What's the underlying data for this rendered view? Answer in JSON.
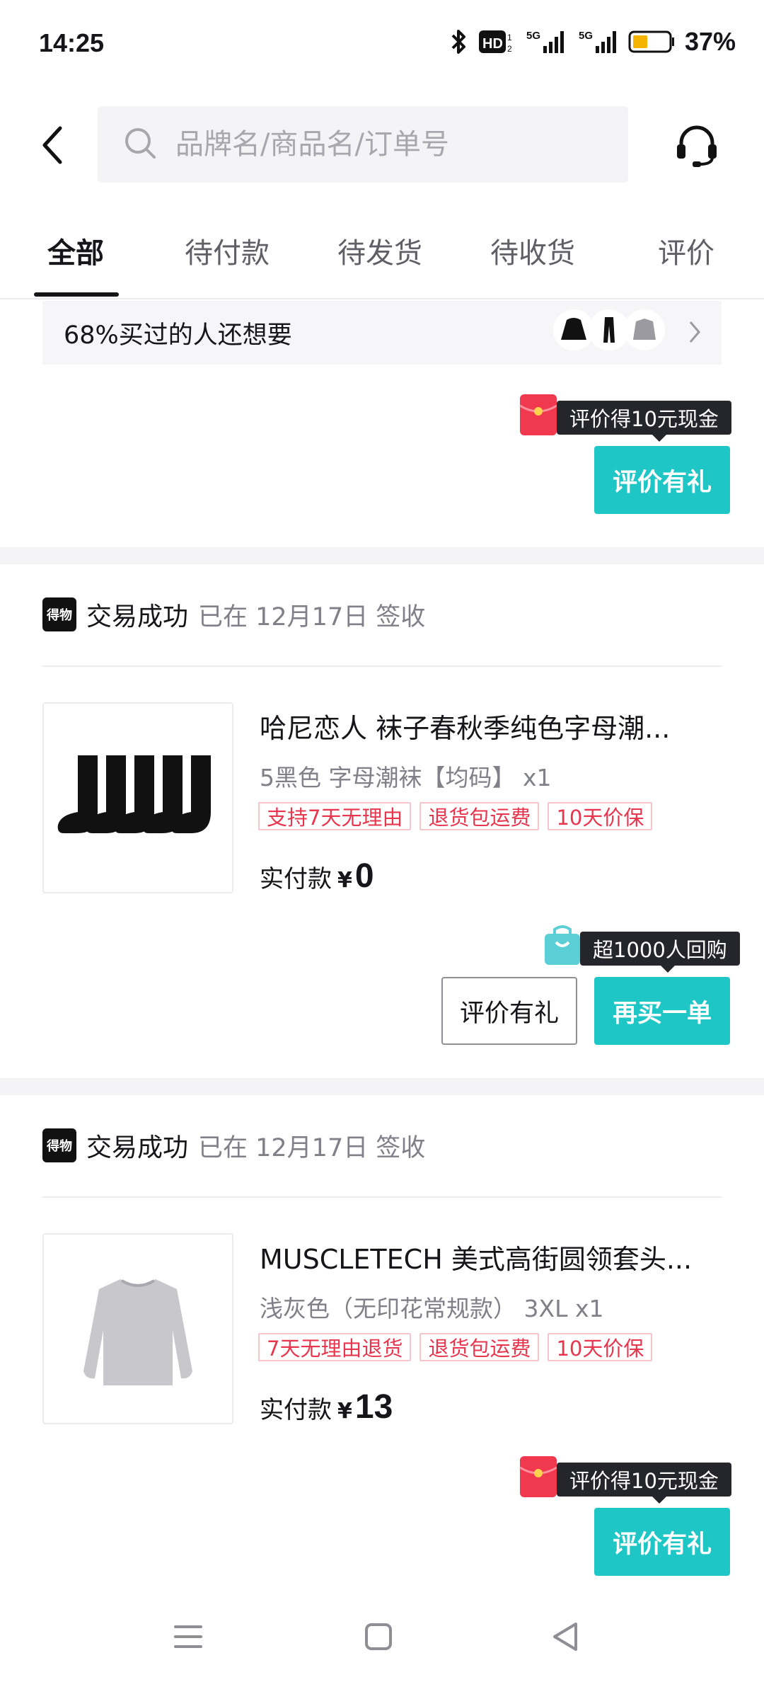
{
  "status_bar": {
    "time": "14:25",
    "battery": "37%",
    "icons": [
      "bluetooth-icon",
      "hd-icon",
      "5g-signal-icon",
      "5g-signal-icon",
      "battery-icon"
    ]
  },
  "header": {
    "search_placeholder": "品牌名/商品名/订单号"
  },
  "tabs": [
    {
      "label": "全部",
      "active": true
    },
    {
      "label": "待付款"
    },
    {
      "label": "待发货"
    },
    {
      "label": "待收货"
    },
    {
      "label": "评价"
    }
  ],
  "recommendation": {
    "text": "68%买过的人还想要"
  },
  "order_top_partial": {
    "tooltip": "评价得10元现金",
    "button": "评价有礼"
  },
  "orders": [
    {
      "shop_logo": "得物",
      "status": "交易成功",
      "date": "已在 12月17日 签收",
      "title": "哈尼恋人 袜子春秋季纯色字母潮...",
      "spec": "5黑色 字母潮袜【均码】 x1",
      "tags": [
        "支持7天无理由",
        "退货包运费",
        "10天价保"
      ],
      "paid_label": "实付款",
      "currency": "¥",
      "amount": "0",
      "tooltip": "超1000人回购",
      "buttons": [
        "评价有礼",
        "再买一单"
      ]
    },
    {
      "shop_logo": "得物",
      "status": "交易成功",
      "date": "已在 12月17日 签收",
      "title": "MUSCLETECH 美式高街圆领套头...",
      "spec": "浅灰色（无印花常规款） 3XL x1",
      "tags": [
        "7天无理由退货",
        "退货包运费",
        "10天价保"
      ],
      "paid_label": "实付款",
      "currency": "¥",
      "amount": "13",
      "tooltip": "评价得10元现金",
      "buttons": [
        "评价有礼"
      ]
    }
  ],
  "colors": {
    "accent": "#1ec6c6",
    "tag_red": "#e8364f",
    "tooltip_bg": "#25252c"
  }
}
